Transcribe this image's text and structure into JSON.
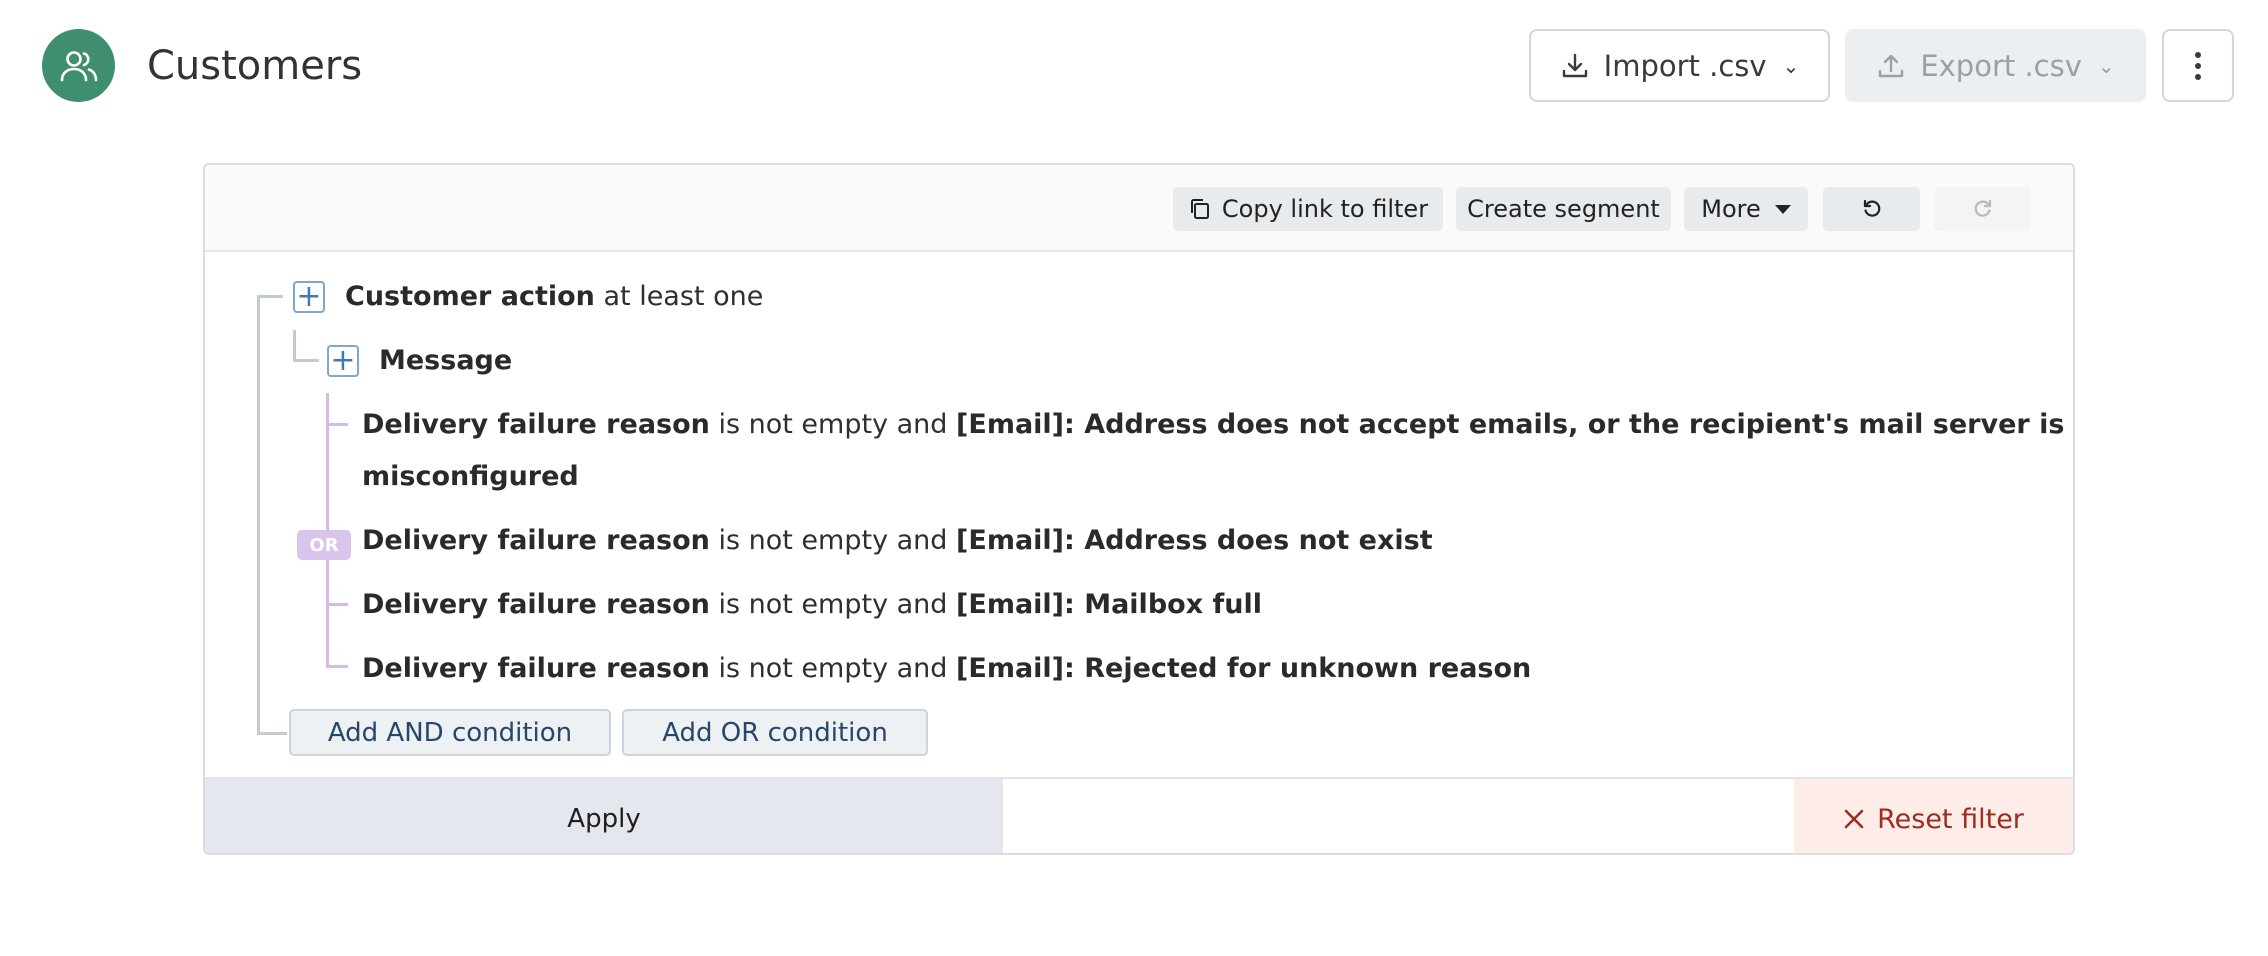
{
  "header": {
    "title": "Customers",
    "avatar_icon": "users-icon",
    "import_label": "Import .csv",
    "export_label": "Export .csv"
  },
  "toolbar": {
    "copy_label": "Copy link to filter",
    "segment_label": "Create segment",
    "more_label": "More"
  },
  "filter": {
    "root": {
      "name": "Customer action",
      "qualifier": "at least one"
    },
    "child": {
      "name": "Message"
    },
    "operator": "OR",
    "conditions": [
      {
        "field": "Delivery failure reason",
        "op": "is not empty and",
        "value": "[Email]: Address does not accept emails, or the recipient's mail server is",
        "value_cont": "misconfigured"
      },
      {
        "field": "Delivery failure reason",
        "op": "is not empty and",
        "value": "[Email]: Address does not exist"
      },
      {
        "field": "Delivery failure reason",
        "op": "is not empty and",
        "value": "[Email]: Mailbox full"
      },
      {
        "field": "Delivery failure reason",
        "op": "is not empty and",
        "value": "[Email]: Rejected for unknown reason"
      }
    ],
    "add_and_label": "Add AND condition",
    "add_or_label": "Add OR condition"
  },
  "footer": {
    "apply_label": "Apply",
    "reset_label": "Reset filter"
  },
  "colors": {
    "accent_green": "#3f8f6e",
    "reset_red": "#9b2d1f",
    "or_purple": "#d9c4ec"
  }
}
